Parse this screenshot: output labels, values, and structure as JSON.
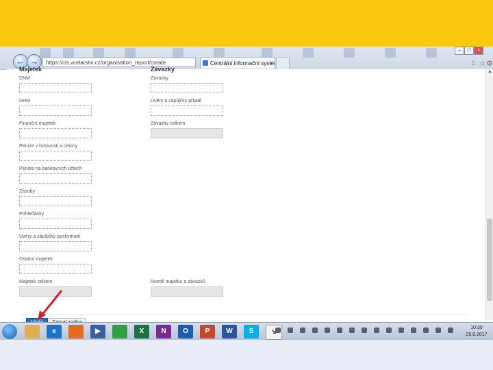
{
  "browser": {
    "address": "https://cis.vcelarstvi.cz/organisation_report/create",
    "tab_title": "Centrální informační systém",
    "tab_close": "×",
    "nav_back": "←",
    "nav_forward": "→",
    "window_min": "–",
    "window_max": "□",
    "window_close": "×"
  },
  "form": {
    "left_heading": "Majetek",
    "right_heading": "Závazky",
    "left_fields": [
      {
        "label": "DNM",
        "readonly": false
      },
      {
        "label": "DHM",
        "readonly": false
      },
      {
        "label": "Finanční majetek",
        "readonly": false
      },
      {
        "label": "Peníze v hotovosti a ceniny",
        "readonly": false
      },
      {
        "label": "Peníze na bankovních účtech",
        "readonly": false
      },
      {
        "label": "Zásoby",
        "readonly": false
      },
      {
        "label": "Pohledávky",
        "readonly": false
      },
      {
        "label": "Úvěry a zápůjčky poskytnuté",
        "readonly": false
      },
      {
        "label": "Ostatní majetek",
        "readonly": false
      },
      {
        "label": "Majetek celkem",
        "readonly": true
      }
    ],
    "right_fields": [
      {
        "label": "Závazky",
        "readonly": false
      },
      {
        "label": "Úvěry a zápůjčky přijaté",
        "readonly": false
      },
      {
        "label": "Závazky celkem",
        "readonly": true
      },
      {
        "label": "Rozdíl majetku a závazků",
        "readonly": true
      }
    ],
    "save_button": "Uložit",
    "draft_button": "Zapsat změny"
  },
  "taskbar": {
    "time": "10:30",
    "date": "25.8.2017",
    "apps": [
      {
        "name": "explorer",
        "glyph": "",
        "color": "#e0b050"
      },
      {
        "name": "internet-explorer",
        "glyph": "e",
        "color": "#1e73c8"
      },
      {
        "name": "firefox",
        "glyph": "",
        "color": "#e66a1f"
      },
      {
        "name": "media-player",
        "glyph": "▶",
        "color": "#3a5f9a"
      },
      {
        "name": "chrome",
        "glyph": "",
        "color": "#2f9e44"
      },
      {
        "name": "excel",
        "glyph": "X",
        "color": "#1e7145"
      },
      {
        "name": "onenote",
        "glyph": "N",
        "color": "#7a2a8e"
      },
      {
        "name": "outlook",
        "glyph": "O",
        "color": "#1e5ea8"
      },
      {
        "name": "powerpoint",
        "glyph": "P",
        "color": "#c8462a"
      },
      {
        "name": "word",
        "glyph": "W",
        "color": "#2b579a"
      },
      {
        "name": "skype",
        "glyph": "S",
        "color": "#00aff0"
      },
      {
        "name": "snipping-tool",
        "glyph": "↘",
        "color": "#f4f4f4"
      }
    ]
  },
  "colors": {
    "top_band": "#fcc70f",
    "bottom_band": "#e9edf7",
    "primary_button": "#2d6cb5",
    "annotation_arrow": "#d3202a"
  }
}
